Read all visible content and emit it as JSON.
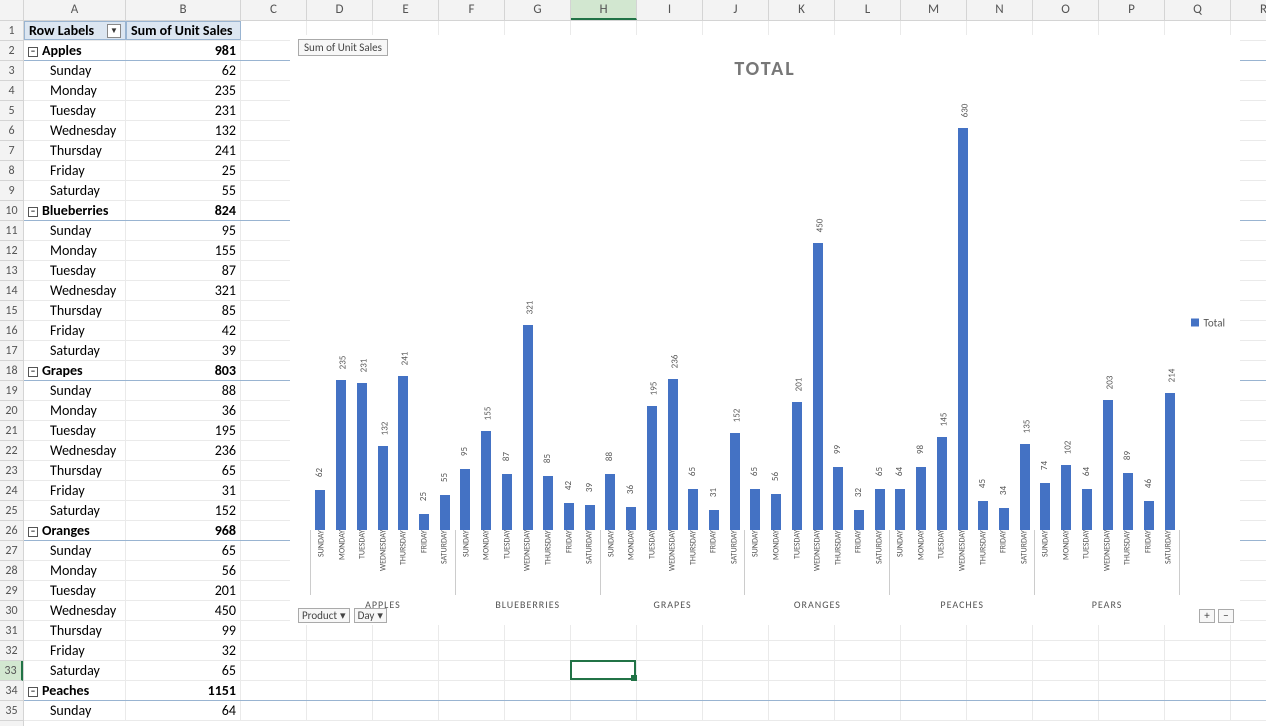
{
  "columns": [
    "A",
    "B",
    "C",
    "D",
    "E",
    "F",
    "G",
    "H",
    "I",
    "J",
    "K",
    "L",
    "M",
    "N",
    "O",
    "P",
    "Q",
    "R"
  ],
  "col_widths": {
    "A": 102,
    "B": 115,
    "default": 66
  },
  "selected_column": "H",
  "selected_row": 33,
  "pivot": {
    "row_labels_header": "Row Labels",
    "value_header": "Sum of Unit Sales",
    "groups": [
      {
        "name": "Apples",
        "total": 981,
        "rows": [
          {
            "d": "Sunday",
            "v": 62
          },
          {
            "d": "Monday",
            "v": 235
          },
          {
            "d": "Tuesday",
            "v": 231
          },
          {
            "d": "Wednesday",
            "v": 132
          },
          {
            "d": "Thursday",
            "v": 241
          },
          {
            "d": "Friday",
            "v": 25
          },
          {
            "d": "Saturday",
            "v": 55
          }
        ]
      },
      {
        "name": "Blueberries",
        "total": 824,
        "rows": [
          {
            "d": "Sunday",
            "v": 95
          },
          {
            "d": "Monday",
            "v": 155
          },
          {
            "d": "Tuesday",
            "v": 87
          },
          {
            "d": "Wednesday",
            "v": 321
          },
          {
            "d": "Thursday",
            "v": 85
          },
          {
            "d": "Friday",
            "v": 42
          },
          {
            "d": "Saturday",
            "v": 39
          }
        ]
      },
      {
        "name": "Grapes",
        "total": 803,
        "rows": [
          {
            "d": "Sunday",
            "v": 88
          },
          {
            "d": "Monday",
            "v": 36
          },
          {
            "d": "Tuesday",
            "v": 195
          },
          {
            "d": "Wednesday",
            "v": 236
          },
          {
            "d": "Thursday",
            "v": 65
          },
          {
            "d": "Friday",
            "v": 31
          },
          {
            "d": "Saturday",
            "v": 152
          }
        ]
      },
      {
        "name": "Oranges",
        "total": 968,
        "rows": [
          {
            "d": "Sunday",
            "v": 65
          },
          {
            "d": "Monday",
            "v": 56
          },
          {
            "d": "Tuesday",
            "v": 201
          },
          {
            "d": "Wednesday",
            "v": 450
          },
          {
            "d": "Thursday",
            "v": 99
          },
          {
            "d": "Friday",
            "v": 32
          },
          {
            "d": "Saturday",
            "v": 65
          }
        ]
      },
      {
        "name": "Peaches",
        "total": 1151,
        "rows": [
          {
            "d": "Sunday",
            "v": 64
          }
        ]
      }
    ]
  },
  "chart": {
    "badge": "Sum of Unit Sales",
    "title": "TOTAL",
    "legend": "Total",
    "filters": [
      "Product",
      "Day"
    ],
    "zoom": {
      "plus": "+",
      "minus": "−"
    }
  },
  "chart_data": {
    "type": "bar",
    "title": "TOTAL",
    "ylabel": "",
    "xlabel": "",
    "ylim": [
      0,
      650
    ],
    "day_categories": [
      "SUNDAY",
      "MONDAY",
      "TUESDAY",
      "WEDNESDAY",
      "THURSDAY",
      "FRIDAY",
      "SATURDAY"
    ],
    "product_categories": [
      "APPLES",
      "BLUEBERRIES",
      "GRAPES",
      "ORANGES",
      "PEACHES",
      "PEARS"
    ],
    "series": [
      {
        "name": "Total",
        "product": "APPLES",
        "values": [
          62,
          235,
          231,
          132,
          241,
          25,
          55
        ]
      },
      {
        "name": "Total",
        "product": "BLUEBERRIES",
        "values": [
          95,
          155,
          87,
          321,
          85,
          42,
          39
        ]
      },
      {
        "name": "Total",
        "product": "GRAPES",
        "values": [
          88,
          36,
          195,
          236,
          65,
          31,
          152
        ]
      },
      {
        "name": "Total",
        "product": "ORANGES",
        "values": [
          65,
          56,
          201,
          450,
          99,
          32,
          65
        ]
      },
      {
        "name": "Total",
        "product": "PEACHES",
        "values": [
          64,
          98,
          145,
          630,
          45,
          34,
          135
        ]
      },
      {
        "name": "Total",
        "product": "PEARS",
        "values": [
          74,
          102,
          64,
          203,
          89,
          46,
          214
        ]
      }
    ]
  }
}
